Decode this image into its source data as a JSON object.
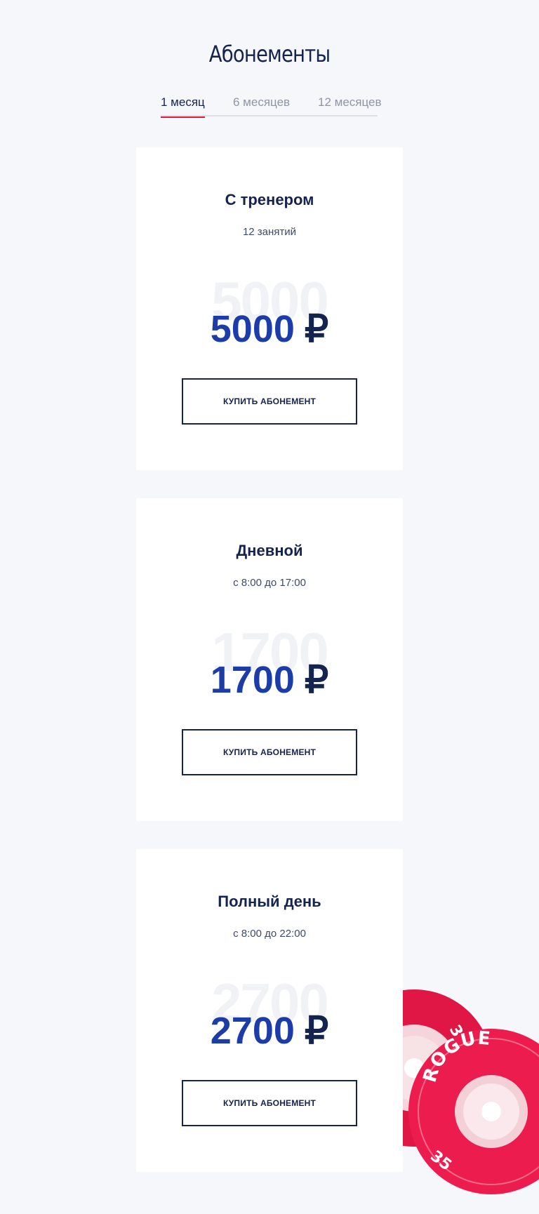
{
  "page": {
    "title": "Абонементы"
  },
  "tabs": [
    {
      "label": "1 месяц",
      "active": true
    },
    {
      "label": "6 месяцев",
      "active": false
    },
    {
      "label": "12 месяцев",
      "active": false
    }
  ],
  "plans": [
    {
      "title": "С тренером",
      "subtitle": "12 занятий",
      "price": "5000",
      "currency": "₽",
      "button": "КУПИТЬ АБОНЕМЕНТ"
    },
    {
      "title": "Дневной",
      "subtitle": "с 8:00 до 17:00",
      "price": "1700",
      "currency": "₽",
      "button": "КУПИТЬ АБОНЕМЕНТ"
    },
    {
      "title": "Полный день",
      "subtitle": "с 8:00 до 22:00",
      "price": "2700",
      "currency": "₽",
      "button": "КУПИТЬ АБОНЕМЕНТ"
    }
  ],
  "decoration": {
    "plate_brand": "ROGUE",
    "plate_weight": "35",
    "plate_color": "#e8194a"
  },
  "colors": {
    "accent": "#e3193d",
    "price": "#1c3ca8",
    "text": "#14244f",
    "background": "#f6f7fb"
  }
}
